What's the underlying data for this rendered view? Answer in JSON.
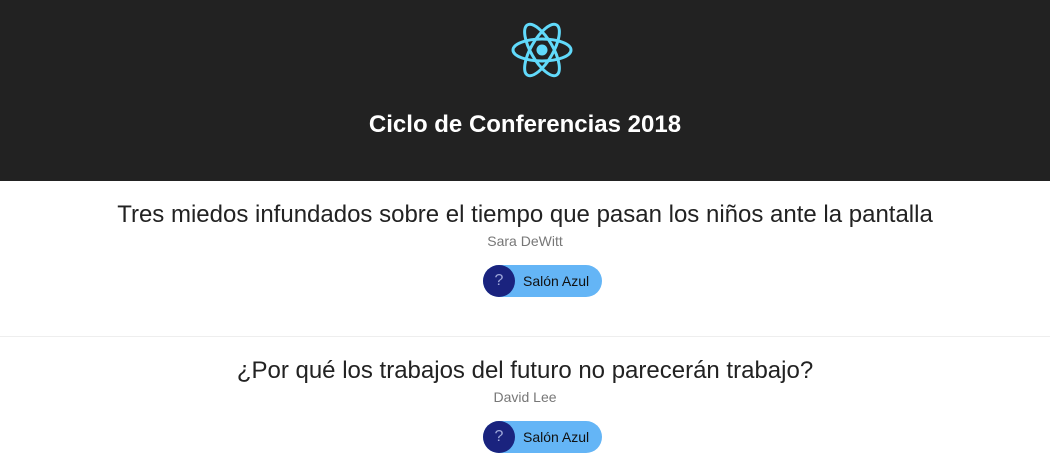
{
  "header": {
    "logo_icon": "react-atom-icon",
    "title": "Ciclo de Conferencias 2018"
  },
  "talks": [
    {
      "title": "Tres miedos infundados sobre el tiempo que pasan los niños ante la pantalla",
      "speaker": "Sara DeWitt",
      "room_icon_text": "?",
      "room": "Salón Azul"
    },
    {
      "title": "¿Por qué los trabajos del futuro no parecerán trabajo?",
      "speaker": "David Lee",
      "room_icon_text": "?",
      "room": "Salón Azul"
    }
  ],
  "colors": {
    "header_bg": "#222222",
    "logo": "#61dafb",
    "room_badge": "#64b5f6",
    "room_icon_bg": "#1a237e"
  }
}
